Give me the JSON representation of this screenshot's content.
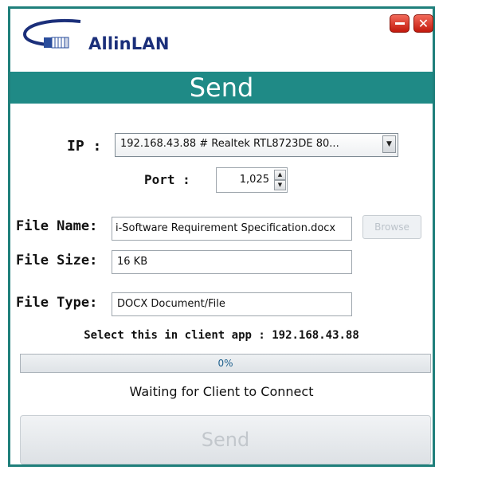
{
  "app": {
    "logo_text": "AllinLAN",
    "title": "Send"
  },
  "window_controls": {
    "minimize_icon": "minus-icon",
    "close_icon": "close-icon",
    "close_glyph": "✕"
  },
  "form": {
    "ip_label": "IP :",
    "ip_value": "192.168.43.88 # Realtek RTL8723DE 80...",
    "ip_dropdown_glyph": "▼",
    "port_label": "Port :",
    "port_value": "1,025",
    "port_up_glyph": "▲",
    "port_down_glyph": "▼",
    "file_name_label": "File Name:",
    "file_name_value": "i-Software Requirement Specification.docx",
    "browse_label": "Browse",
    "file_size_label": "File Size:",
    "file_size_value": "16 KB",
    "file_type_label": "File Type:",
    "file_type_value": "DOCX Document/File"
  },
  "info_text": "Select this in client app : 192.168.43.88",
  "progress": {
    "value": 0,
    "text": "0%"
  },
  "status_text": "Waiting for Client to Connect",
  "send_button_label": "Send",
  "colors": {
    "accent": "#1f8a86",
    "logo": "#1b2f7a",
    "close_button": "#d9271a"
  }
}
